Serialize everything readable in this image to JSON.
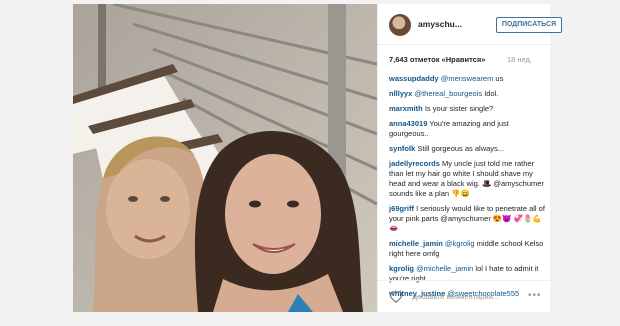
{
  "post": {
    "username": "amyschu...",
    "follow_label": "ПОДПИСАТЬСЯ",
    "likes": "7,643 отметок «Нравится»",
    "age": "18 нед.",
    "comments": [
      {
        "user": "wassupdaddy",
        "mention": "@menswearem",
        "text": " us"
      },
      {
        "user": "nlllyyx",
        "mention": "@thereal_bourgeois",
        "text": " Idol."
      },
      {
        "user": "marxmith",
        "mention": "",
        "text": " Is your sister single?"
      },
      {
        "user": "anna43019",
        "mention": "",
        "text": " You're amazing and just gourgeous.."
      },
      {
        "user": "synfolk",
        "mention": "",
        "text": " Still gorgeous as always..."
      },
      {
        "user": "jadellyrecords",
        "mention": "",
        "text": " My uncle just told me rather than let my hair go white I should shave my head and wear a black wig. 🎩 @amyschumer sounds like a plan 👎😄"
      },
      {
        "user": "j69griff",
        "mention": "",
        "text": " I seriously would like to penetrate all of your pink parts @amyschumer 😍😈 💞🌷💪👄"
      },
      {
        "user": "michelle_jamin",
        "mention": "@kgrolig",
        "text": " middle school Kelso right here omfg"
      },
      {
        "user": "kgrolig",
        "mention": "@michelle_jamin",
        "text": " lol I hate to admit it you're right"
      },
      {
        "user": "whitney_justine",
        "mention": "@sweetchocolate555",
        "text": ""
      }
    ],
    "add_comment_placeholder": "Добавьте комментарий...",
    "more_label": "•••"
  }
}
